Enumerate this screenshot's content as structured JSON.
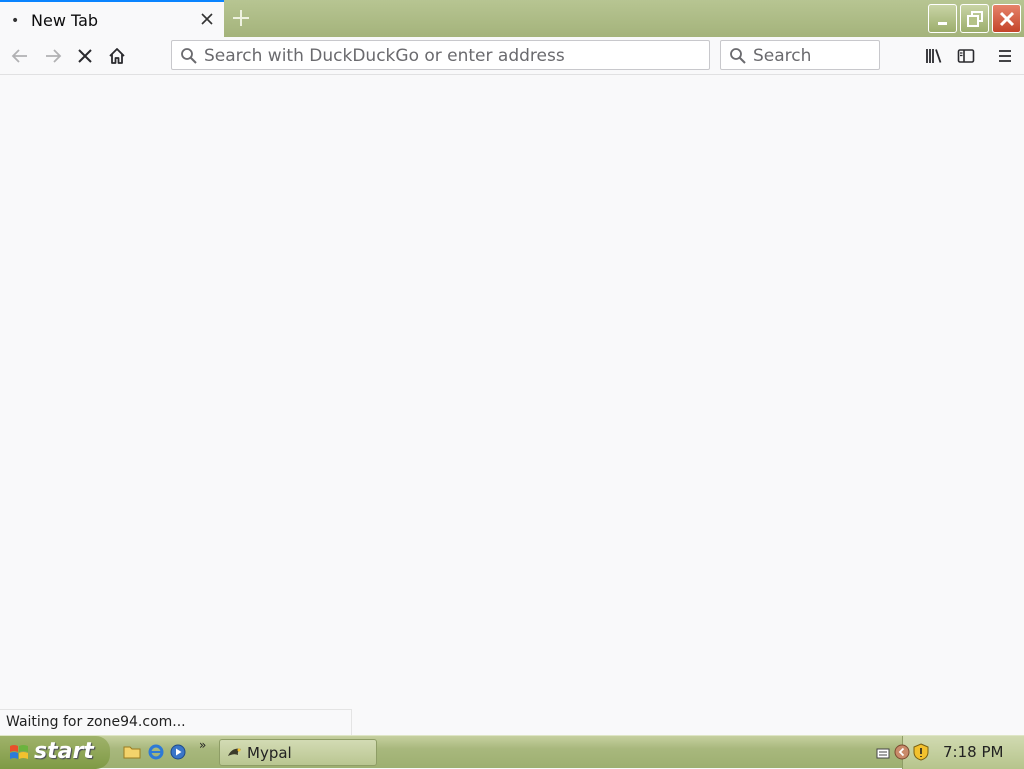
{
  "browser": {
    "tabs": [
      {
        "title": "New Tab",
        "loading": true
      }
    ],
    "address_bar": {
      "placeholder": "Search with DuckDuckGo or enter address"
    },
    "search_bar": {
      "placeholder": "Search"
    },
    "status_text": "Waiting for zone94.com..."
  },
  "taskbar": {
    "start_label": "start",
    "tasks": [
      {
        "label": "Mypal"
      }
    ],
    "clock": "7:18 PM"
  },
  "colors": {
    "tab_accent": "#0a84ff",
    "chrome_bg": "#f9f9fa",
    "titlebar_olive": "#a4b37b",
    "close_red": "#c4442a"
  }
}
